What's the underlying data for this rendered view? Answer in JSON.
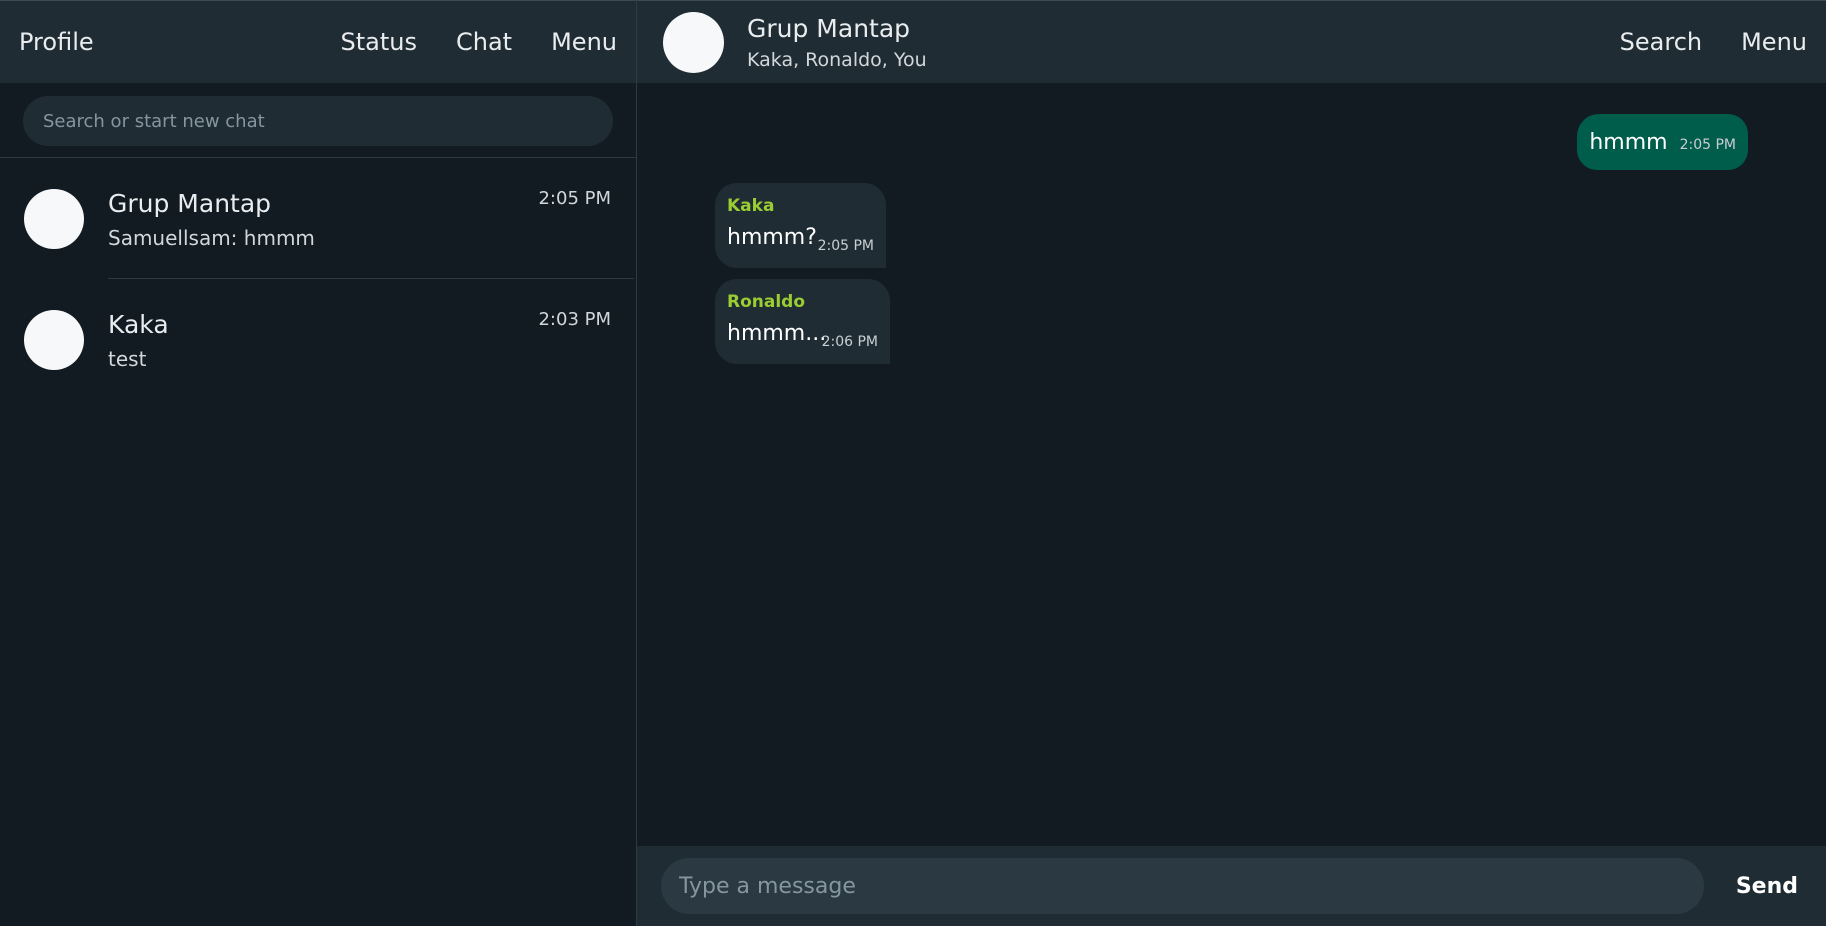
{
  "sidebar": {
    "header": {
      "profile_label": "Profile",
      "status_label": "Status",
      "chat_label": "Chat",
      "menu_label": "Menu"
    },
    "search": {
      "placeholder": "Search or start new chat",
      "value": ""
    },
    "chats": [
      {
        "name": "Grup Mantap",
        "preview": "Samuellsam: hmmm",
        "time": "2:05 PM"
      },
      {
        "name": "Kaka",
        "preview": "test",
        "time": "2:03 PM"
      }
    ]
  },
  "conversation": {
    "header": {
      "title": "Grup Mantap",
      "members": "Kaka, Ronaldo, You",
      "search_label": "Search",
      "menu_label": "Menu"
    },
    "messages": [
      {
        "direction": "outgoing",
        "sender": "",
        "text": "hmmm",
        "time": "2:05 PM"
      },
      {
        "direction": "incoming",
        "sender": "Kaka",
        "text": "hmmm?",
        "time": "2:05 PM"
      },
      {
        "direction": "incoming",
        "sender": "Ronaldo",
        "text": "hmmm...",
        "time": "2:06 PM"
      }
    ],
    "composer": {
      "placeholder": "Type a message",
      "value": "",
      "send_label": "Send"
    }
  },
  "colors": {
    "background": "#111b21",
    "panel_header": "#202c33",
    "outgoing_bubble": "#005c4b",
    "incoming_bubble": "#202c33",
    "sender_name": "#9acd32"
  }
}
